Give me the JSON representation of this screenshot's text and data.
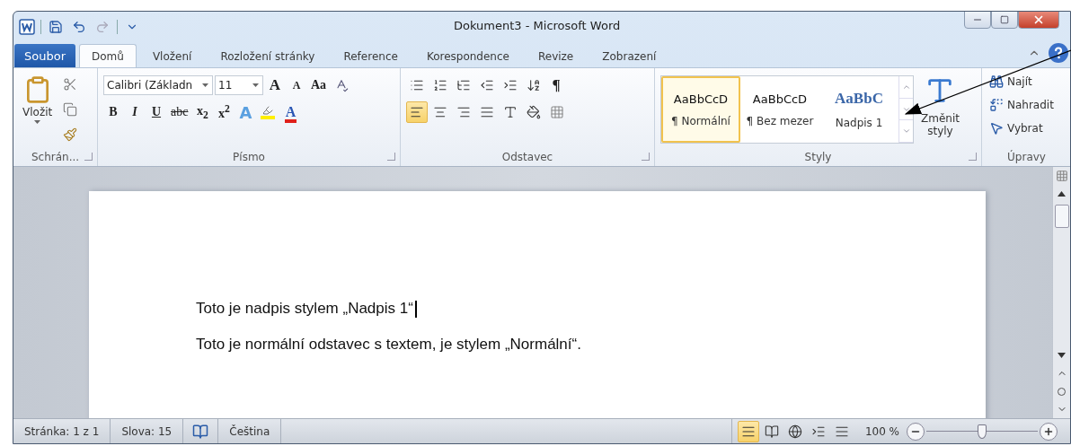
{
  "window": {
    "title": "Dokument3 - Microsoft Word"
  },
  "file_tab": {
    "label": "Soubor"
  },
  "tabs": [
    {
      "label": "Domů",
      "selected": true
    },
    {
      "label": "Vložení",
      "selected": false
    },
    {
      "label": "Rozložení stránky",
      "selected": false
    },
    {
      "label": "Reference",
      "selected": false
    },
    {
      "label": "Korespondence",
      "selected": false
    },
    {
      "label": "Revize",
      "selected": false
    },
    {
      "label": "Zobrazení",
      "selected": false
    }
  ],
  "clipboard": {
    "label": "Schrán...",
    "paste": "Vložit"
  },
  "font": {
    "label": "Písmo",
    "font_name": "Calibri (Základn",
    "font_size": "11",
    "grow": "A",
    "shrink": "A",
    "case": "Aa",
    "format_buttons": [
      {
        "kind": "bold",
        "label": "B"
      },
      {
        "kind": "italic",
        "label": "I"
      },
      {
        "kind": "underline",
        "label": "U"
      },
      {
        "kind": "strike",
        "label": "abc"
      },
      {
        "kind": "sub",
        "label": "x$_{2}$"
      },
      {
        "kind": "sup",
        "label": "x$^{2}$"
      }
    ],
    "effects": "A",
    "font_color": "A"
  },
  "paragraph": {
    "label": "Odstavec",
    "marks": "¶",
    "align": [
      {
        "kind": "left",
        "selected": true
      },
      {
        "kind": "center",
        "selected": false
      },
      {
        "kind": "right",
        "selected": false
      },
      {
        "kind": "justify",
        "selected": false
      }
    ]
  },
  "styles": {
    "label": "Styly",
    "change_line1": "Změnit",
    "change_line2": "styly",
    "items": [
      {
        "preview": "AaBbCcD",
        "name": "¶ Normální",
        "kind": "normal",
        "selected": true
      },
      {
        "preview": "AaBbCcD",
        "name": "¶ Bez mezer",
        "kind": "normal",
        "selected": false
      },
      {
        "preview": "AaBbC",
        "name": "Nadpis 1",
        "kind": "heading",
        "selected": false
      }
    ]
  },
  "editing": {
    "label": "Úpravy",
    "find": "Najít",
    "replace": "Nahradit",
    "select": "Vybrat"
  },
  "document": {
    "paragraphs": [
      {
        "text": "Toto je nadpis stylem „Nadpis 1“",
        "cursor": true
      },
      {
        "text": "Toto je normální odstavec s textem, je stylem „Normální“.",
        "cursor": false
      }
    ]
  },
  "status_bar": {
    "page": "Stránka: 1 z 1",
    "words": "Slova: 15",
    "language": "Čeština",
    "views": [
      {
        "kind": "print",
        "selected": true
      },
      {
        "kind": "reading",
        "selected": false
      },
      {
        "kind": "web",
        "selected": false
      },
      {
        "kind": "outline",
        "selected": false
      },
      {
        "kind": "draft",
        "selected": false
      }
    ],
    "zoom": "100 %",
    "zoom_slider": {
      "level": 0.5
    }
  }
}
